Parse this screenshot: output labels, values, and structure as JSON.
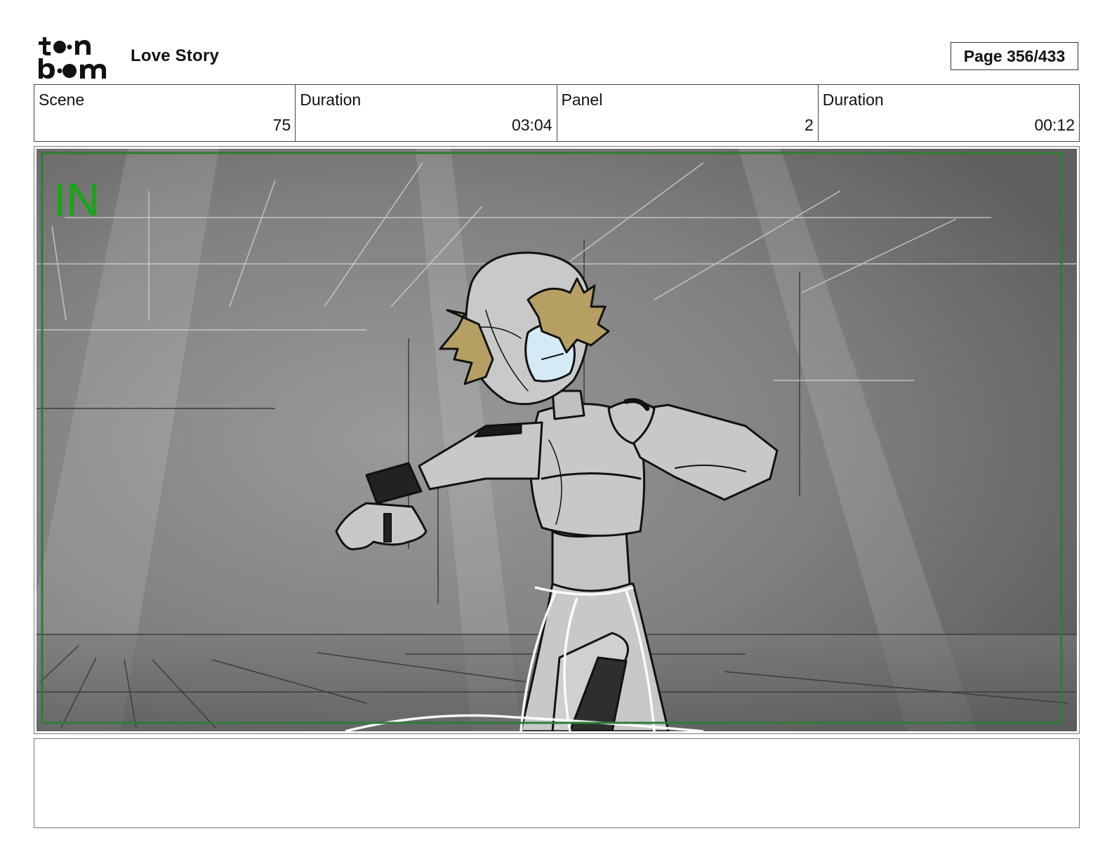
{
  "header": {
    "logo_text": "toon boom",
    "project_title": "Love Story",
    "page_label": "Page 356/433"
  },
  "info": [
    {
      "label": "Scene",
      "value": "75"
    },
    {
      "label": "Duration",
      "value": "03:04"
    },
    {
      "label": "Panel",
      "value": "2"
    },
    {
      "label": "Duration",
      "value": "00:12"
    }
  ],
  "panel": {
    "marker": "IN",
    "marker_color": "#14a814",
    "safe_frame_color": "#2e7d32"
  },
  "notes": {
    "text": ""
  }
}
